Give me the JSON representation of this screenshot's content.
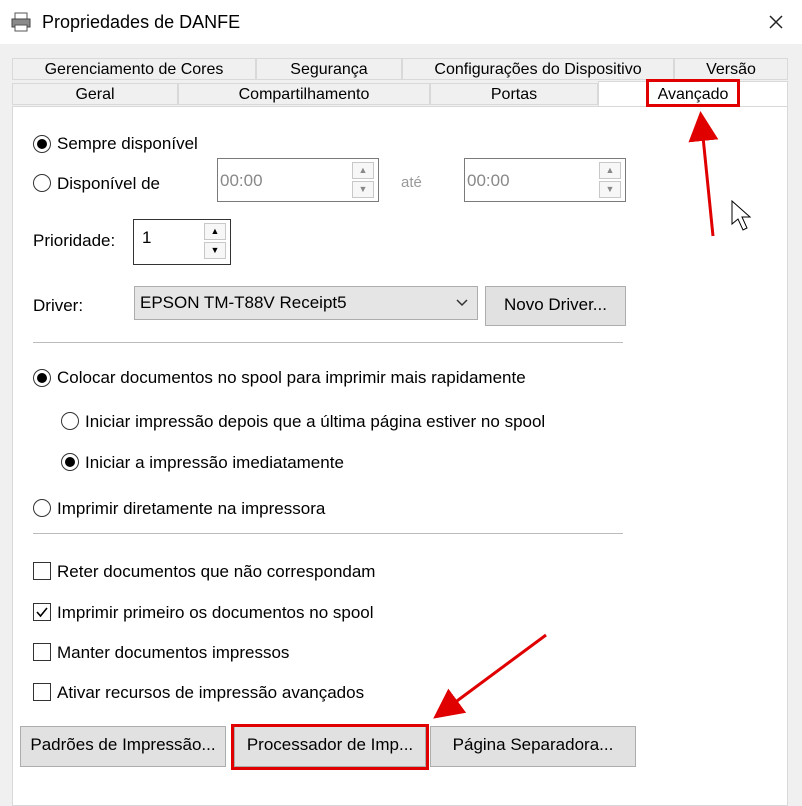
{
  "window": {
    "title": "Propriedades de DANFE"
  },
  "tabs": {
    "row1": [
      "Gerenciamento de Cores",
      "Segurança",
      "Configurações do Dispositivo",
      "Versão"
    ],
    "row2": [
      "Geral",
      "Compartilhamento",
      "Portas",
      "Avançado"
    ],
    "active": "Avançado"
  },
  "availability": {
    "always_label": "Sempre disponível",
    "from_label": "Disponível de",
    "until_label": "até",
    "from_time": "00:00",
    "to_time": "00:00",
    "selected": "always"
  },
  "priority": {
    "label": "Prioridade:",
    "value": "1"
  },
  "driver": {
    "label": "Driver:",
    "selected": "EPSON TM-T88V Receipt5",
    "new_driver_button": "Novo Driver..."
  },
  "spool": {
    "spool_label": "Colocar documentos no spool para imprimir mais rapidamente",
    "after_last_page_label": "Iniciar impressão depois que a última página estiver no spool",
    "immediately_label": "Iniciar a impressão imediatamente",
    "direct_label": "Imprimir diretamente na impressora",
    "selected": "spool",
    "sub_selected": "immediately"
  },
  "options": [
    {
      "label": "Reter documentos que não correspondam",
      "checked": false
    },
    {
      "label": "Imprimir primeiro os documentos no spool",
      "checked": true
    },
    {
      "label": "Manter documentos impressos",
      "checked": false
    },
    {
      "label": "Ativar recursos de impressão avançados",
      "checked": false
    }
  ],
  "buttons": {
    "defaults": "Padrões de Impressão...",
    "processor": "Processador de Imp...",
    "separator": "Página Separadora..."
  },
  "colors": {
    "annotation_red": "#e00000",
    "panel_bg": "#ffffff",
    "window_bg": "#f0f0f0"
  }
}
